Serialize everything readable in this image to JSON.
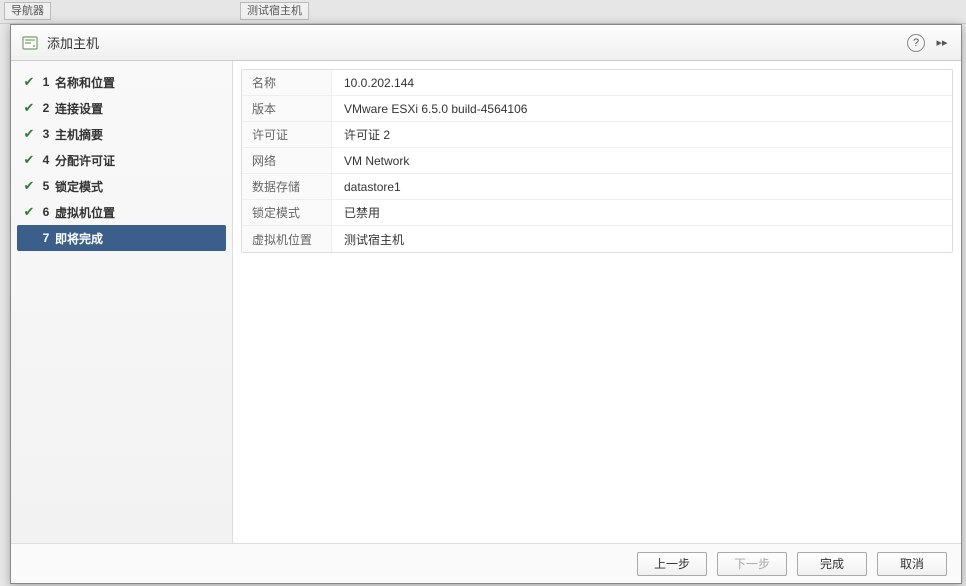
{
  "dialog": {
    "title": "添加主机"
  },
  "steps": [
    {
      "num": "1",
      "label": "名称和位置",
      "done": true,
      "active": false
    },
    {
      "num": "2",
      "label": "连接设置",
      "done": true,
      "active": false
    },
    {
      "num": "3",
      "label": "主机摘要",
      "done": true,
      "active": false
    },
    {
      "num": "4",
      "label": "分配许可证",
      "done": true,
      "active": false
    },
    {
      "num": "5",
      "label": "锁定模式",
      "done": true,
      "active": false
    },
    {
      "num": "6",
      "label": "虚拟机位置",
      "done": true,
      "active": false
    },
    {
      "num": "7",
      "label": "即将完成",
      "done": true,
      "active": true
    }
  ],
  "summary": {
    "name_key": "名称",
    "name_val": "10.0.202.144",
    "version_key": "版本",
    "version_val": "VMware ESXi 6.5.0 build-4564106",
    "license_key": "许可证",
    "license_val": "许可证 2",
    "network_key": "网络",
    "network_val": "VM Network",
    "datastore_key": "数据存储",
    "datastore_val": "datastore1",
    "lock_key": "锁定模式",
    "lock_val": "已禁用",
    "vmloc_key": "虚拟机位置",
    "vmloc_val": "测试宿主机"
  },
  "buttons": {
    "prev": "上一步",
    "next": "下一步",
    "finish": "完成",
    "cancel": "取消"
  }
}
